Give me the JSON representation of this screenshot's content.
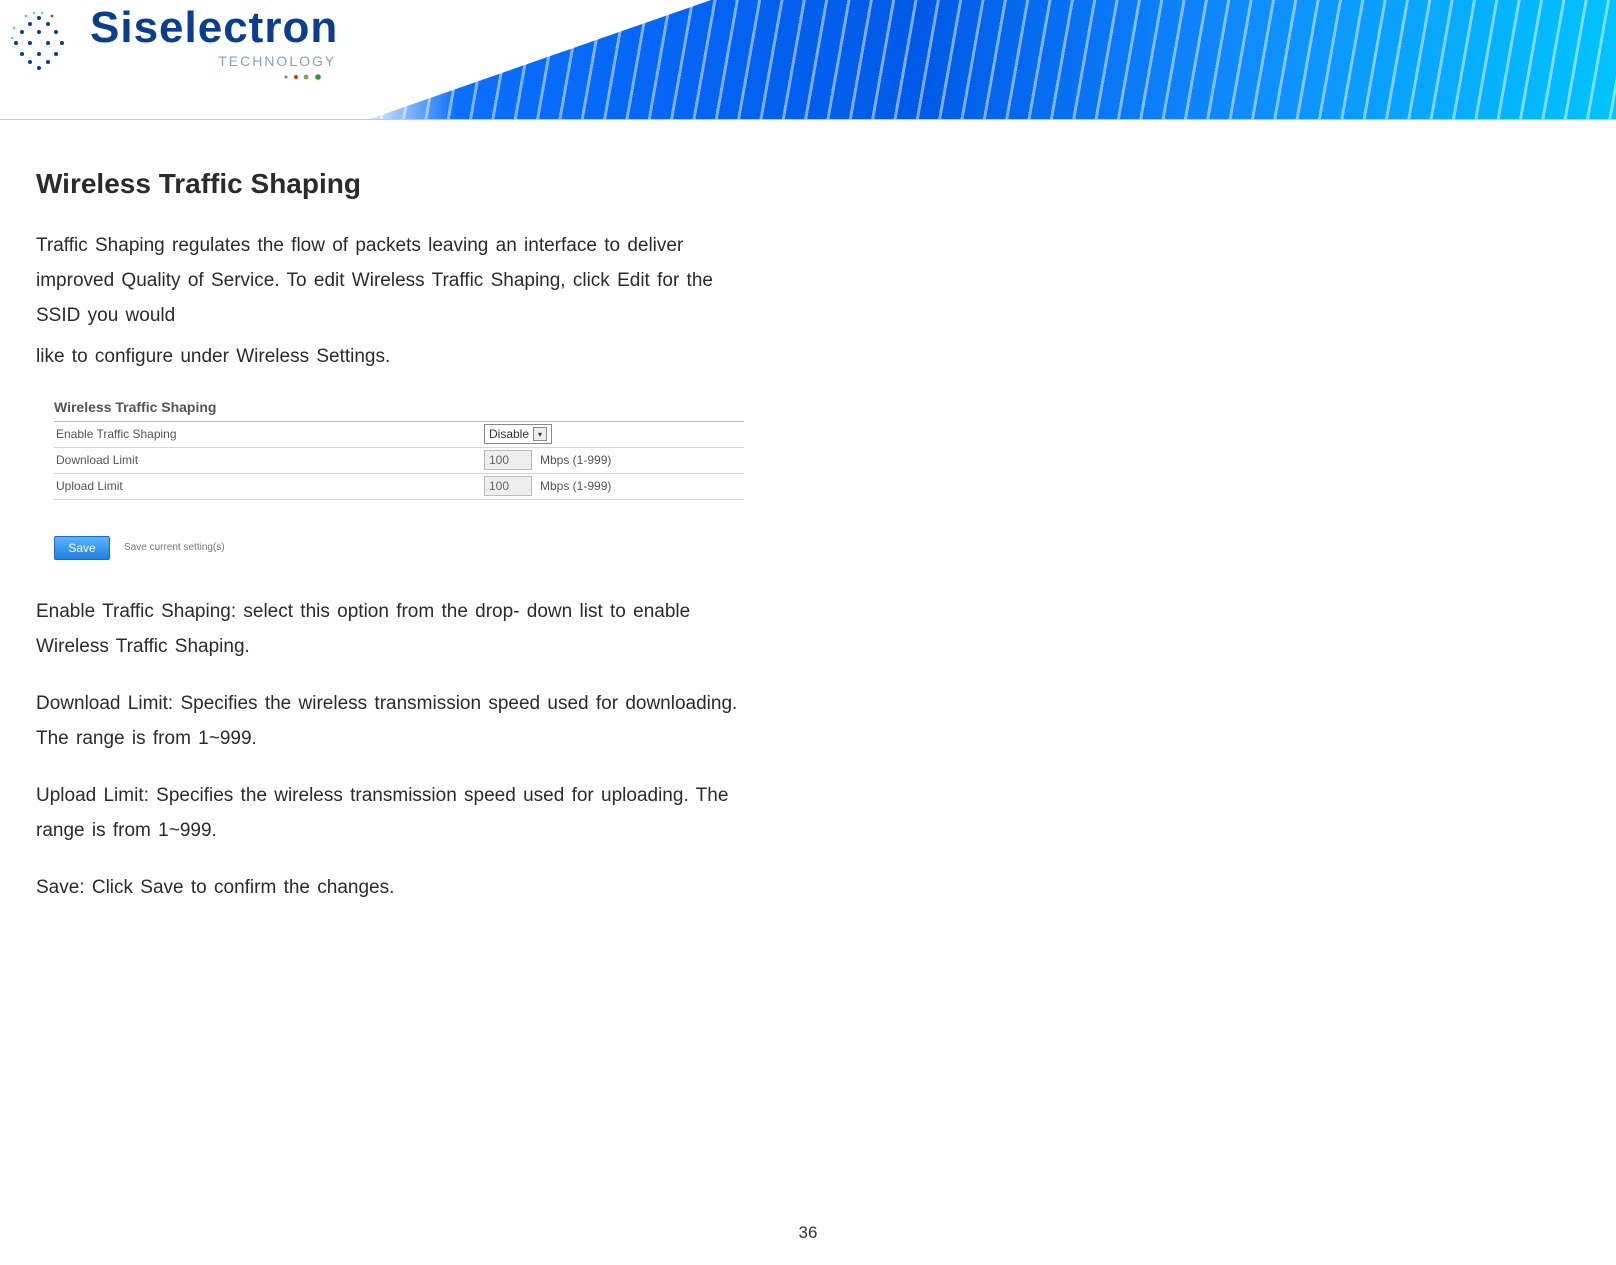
{
  "brand": {
    "name": "Siselectron",
    "sub": "TECHNOLOGY"
  },
  "title": "Wireless Traffic Shaping",
  "intro": {
    "p1a": "Traffic Shaping ",
    "p1b": "regulates",
    "p1c": " the flow of packets leaving ",
    "p1d": "an interface",
    "p1e": " to deliver improved Quality of Service. To ",
    "p1f": "edit",
    "p1g": " Wireless Traffic Shaping, click Edit for the ",
    "p1h": "SSID",
    "p1i": " you would",
    "p2a": "like to configure under ",
    "p2b": "Wireless Settings",
    "p2c": "."
  },
  "shot": {
    "section_title": "Wireless Traffic Shaping",
    "rows": {
      "enable_label": "Enable Traffic Shaping",
      "enable_value": "Disable",
      "download_label": "Download Limit",
      "download_value": "100",
      "download_unit": "Mbps (1-999)",
      "upload_label": "Upload Limit",
      "upload_value": "100",
      "upload_unit": "Mbps (1-999)"
    },
    "save_btn": "Save",
    "save_sub": "Save current setting(s)"
  },
  "defs": {
    "d1": "Enable Traffic Shaping: select this option from the drop- down list to enable Wireless Traffic Shaping.",
    "d2": "Download Limit: Specifies the wireless transmission speed used for downloading. The range is from 1~999.",
    "d3": "Upload Limit: Specifies the wireless transmission speed used for uploading. The range is from 1~999.",
    "d4": "Save: Click Save to confirm the changes."
  },
  "page_number": "36"
}
